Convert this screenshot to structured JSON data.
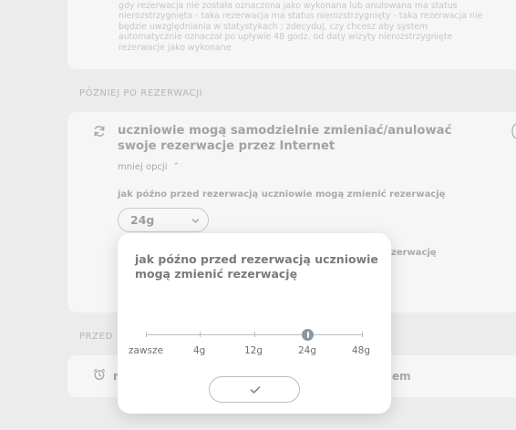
{
  "top_card": {
    "text": "gdy rezerwacja nie została oznaczona jako wykonana lub anulowana ma status nierozstrzygnięta - taka rezerwacja ma status nierozstrzygnięty - taka rezerwacja nie będzie uwzględniania w statystykach ; zdecyduj, czy chcesz aby system automatycznie oznaczał po upływie 48 godz. od daty wizyty nierozstrzygnięte rezerwacje jako wykonane"
  },
  "sections": {
    "pozniej_label": "PÓŹNIEJ PO REZERWACJI",
    "przed_label": "PRZED"
  },
  "setting": {
    "title": "uczniowie mogą samodzielnie zmieniać/anulować swoje rezerwacje przez Internet",
    "less_options": "mniej opcji",
    "field_label": "jak późno przed rezerwacją uczniowie mogą zmienić rezerwację",
    "dropdown_value": "24g",
    "field_label_2_fragment": "zerwację"
  },
  "bottom_card": {
    "fragment_left": "r",
    "fragment_right": "em"
  },
  "modal": {
    "title": "jak późno przed rezerwacją uczniowie mogą zmienić rezerwację",
    "options": [
      "zawsze",
      "4g",
      "12g",
      "24g",
      "48g"
    ],
    "selected": "24g",
    "selected_index": 3
  },
  "icons": {
    "sync": "sync-icon",
    "toggle": "toggle-switch-icon",
    "alarm": "alarm-clock-icon",
    "check": "checkmark-icon",
    "chevron_up": "chevron-up-icon",
    "chevron_down": "chevron-down-icon"
  },
  "colors": {
    "background": "#ececec",
    "card": "#f6f6f6",
    "modal": "#ffffff",
    "slider_thumb": "#8c98a0"
  }
}
